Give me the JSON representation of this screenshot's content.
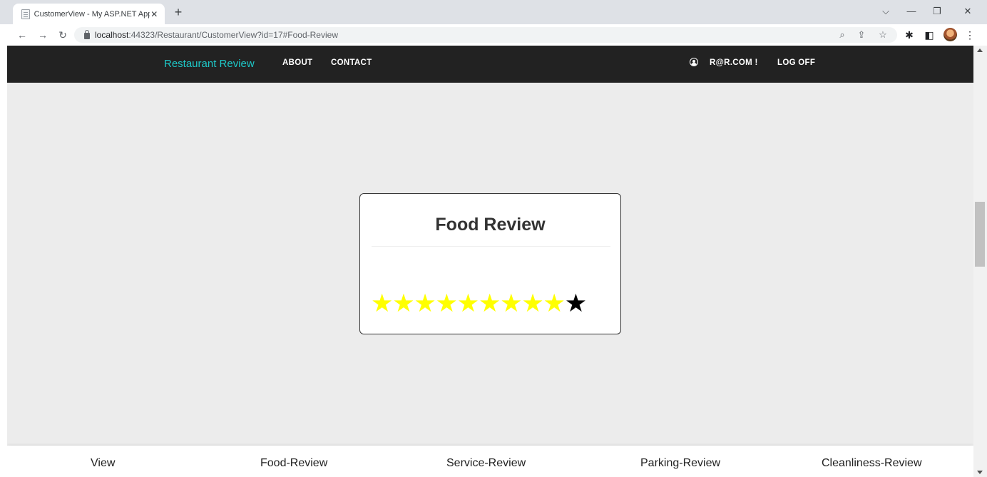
{
  "browser": {
    "tab_title": "CustomerView - My ASP.NET App",
    "tab_close": "✕",
    "new_tab": "+",
    "url_host": "localhost",
    "url_path": ":44323/Restaurant/CustomerView?id=17#Food-Review",
    "icons": [
      "back-icon",
      "forward-icon",
      "reload-icon",
      "lock-icon",
      "zoom-icon",
      "share-icon",
      "bookmark-star-icon",
      "extensions-icon",
      "sidebar-icon",
      "profile-avatar",
      "menu-icon"
    ]
  },
  "navbar": {
    "brand": "Restaurant Review",
    "about": "ABOUT",
    "contact": "CONTACT",
    "user": "R@R.COM !",
    "logoff": "LOG OFF"
  },
  "card": {
    "title": "Food Review",
    "rating": 9,
    "max_rating": 10
  },
  "footer": {
    "view": "View",
    "food": "Food-Review",
    "service": "Service-Review",
    "parking": "Parking-Review",
    "cleanliness": "Cleanliness-Review"
  },
  "colors": {
    "brand": "#1ec8c8",
    "navbar_bg": "#222222",
    "page_bg": "#ececec",
    "star_filled": "#ffff00",
    "star_empty": "#000000"
  }
}
